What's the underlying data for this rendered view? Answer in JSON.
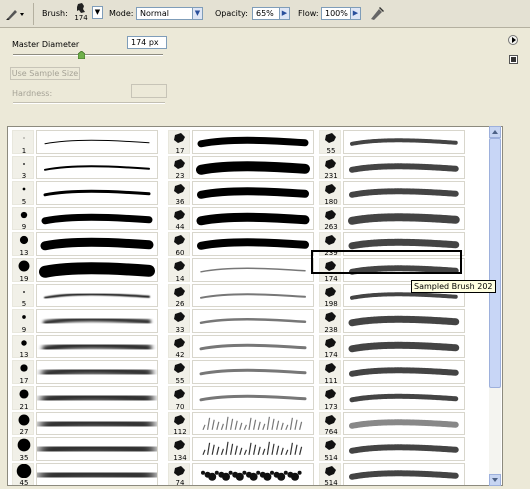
{
  "options_bar": {
    "brush_label": "Brush:",
    "brush_size": "174",
    "mode_label": "Mode:",
    "mode_value": "Normal",
    "opacity_label": "Opacity:",
    "opacity_value": "65%",
    "flow_label": "Flow:",
    "flow_value": "100%"
  },
  "picker": {
    "master_diameter_label": "Master Diameter",
    "master_diameter_value": "174 px",
    "master_diameter_fraction": 0.45,
    "use_sample_size_label": "Use Sample Size",
    "hardness_label": "Hardness:",
    "hardness_value": ""
  },
  "brushes": {
    "col1": [
      "1",
      "3",
      "5",
      "9",
      "13",
      "19",
      "5",
      "9",
      "13",
      "17",
      "21",
      "27",
      "35",
      "45"
    ],
    "col2": [
      "17",
      "23",
      "36",
      "44",
      "60",
      "14",
      "26",
      "33",
      "42",
      "55",
      "70",
      "112",
      "134",
      "74"
    ],
    "col3": [
      "55",
      "231",
      "180",
      "263",
      "239",
      "174",
      "198",
      "238",
      "174",
      "111",
      "173",
      "764",
      "514",
      "514"
    ]
  },
  "tooltip": "Sampled Brush 202"
}
